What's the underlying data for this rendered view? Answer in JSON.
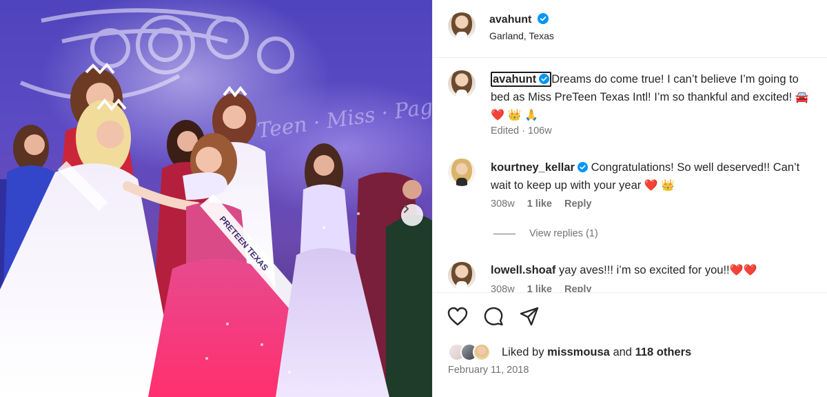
{
  "post": {
    "author": "avahunt",
    "location": "Garland, Texas",
    "caption": {
      "username": "avahunt",
      "text_line1": "Dreams do come true! I can’t believe I’m going to",
      "text_line2": "bed as Miss PreTeen Texas Intl! I’m so thankful and excited!",
      "emoji_1": "🚘",
      "emoji_2": "❤️",
      "emoji_3": "👑",
      "emoji_4": "🙏",
      "edited": "Edited",
      "time": "106w"
    },
    "photo": {
      "sash_text": "PRETEEN TEXAS",
      "backdrop_text": "Teen · Miss · Pageant"
    }
  },
  "comments": [
    {
      "username": "kourtney_kellar",
      "text_line1": "Congratulations! So well deserved!! Can’t",
      "text_line2": "wait to keep up with your year",
      "emoji_1": "❤️",
      "emoji_2": "👑",
      "time": "308w",
      "likes": "1 like",
      "reply": "Reply",
      "view_replies": "View replies (1)"
    },
    {
      "username": "lowell.shoaf",
      "text": "yay aves!!! i’m so excited for you!!",
      "emoji_1": "❤️",
      "emoji_2": "❤️",
      "time": "308w",
      "likes": "1 like",
      "reply": "Reply"
    }
  ],
  "likes": {
    "prefix": "Liked by",
    "user": "missmousa",
    "and": "and",
    "others": "118 others"
  },
  "date": "February 11, 2018",
  "icons": {
    "verified": "verified-badge-icon",
    "like": "heart-icon",
    "comment": "comment-bubble-icon",
    "share": "send-icon",
    "next": "chevron-right-icon"
  },
  "colors": {
    "verified": "#0095f6",
    "meta_text": "#737373",
    "heart": "#d21f3c",
    "stage_purple": "#5d4bc3"
  }
}
